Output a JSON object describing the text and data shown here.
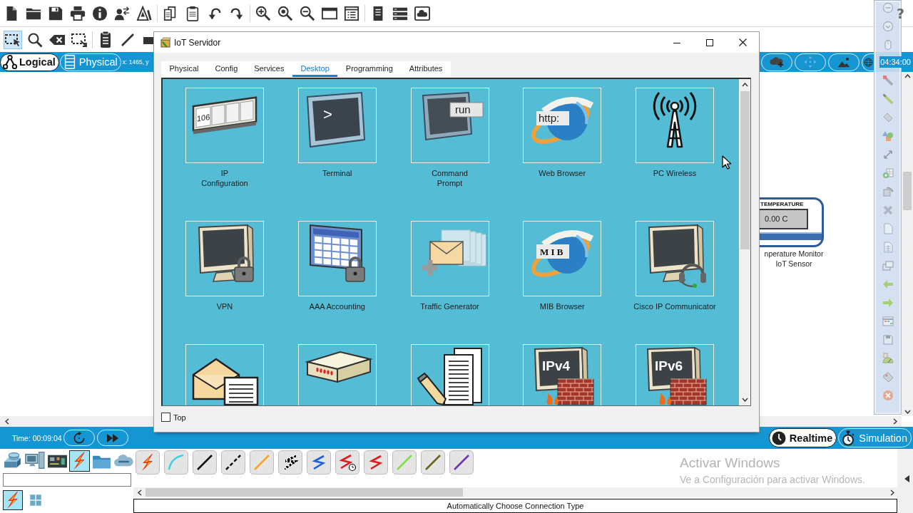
{
  "help": "?",
  "edit_tools": [
    {
      "selected": true
    },
    {
      "selected": false
    },
    {
      "selected": false
    },
    {
      "selected": false
    },
    {
      "selected": false
    },
    {
      "selected": false
    },
    {
      "selected": false
    }
  ],
  "workspace_tabs": [
    {
      "label": "Logical",
      "selected": true
    },
    {
      "label": "Physical",
      "selected": false
    }
  ],
  "cursor_coordinates": "x: 1465, y",
  "clock": "04:34:00",
  "canvas": {
    "device": {
      "display_title": "TEMPERATURE",
      "reading": "0.00 C",
      "name": "nperature Monitor\nIoT Sensor"
    }
  },
  "dialog": {
    "title": "IoT Servidor",
    "tabs": [
      {
        "label": "Physical",
        "selected": false
      },
      {
        "label": "Config",
        "selected": false
      },
      {
        "label": "Services",
        "selected": false
      },
      {
        "label": "Desktop",
        "selected": true
      },
      {
        "label": "Programming",
        "selected": false
      },
      {
        "label": "Attributes",
        "selected": false
      }
    ],
    "apps": [
      {
        "label": "IP\nConfiguration",
        "icon_text": "106",
        "clipped": false
      },
      {
        "label": "Terminal",
        "icon_text": ">",
        "clipped": false
      },
      {
        "label": "Command\nPrompt",
        "icon_text": "run",
        "clipped": false
      },
      {
        "label": "Web Browser",
        "icon_text": "http:",
        "clipped": false
      },
      {
        "label": "PC Wireless",
        "clipped": false
      },
      {
        "label": "VPN",
        "clipped": false
      },
      {
        "label": "AAA Accounting",
        "clipped": false
      },
      {
        "label": "Traffic Generator",
        "clipped": false
      },
      {
        "label": "MIB Browser",
        "icon_text": "M I B",
        "clipped": false
      },
      {
        "label": "Cisco IP Communicator",
        "clipped": false
      },
      {
        "clipped": true
      },
      {
        "clipped": true
      },
      {
        "clipped": true
      },
      {
        "icon_text": "IPv4",
        "clipped": true
      },
      {
        "icon_text": "IPv6",
        "clipped": true
      }
    ],
    "top": {
      "label": "Top",
      "checked": false
    }
  },
  "time_bar": {
    "time": "Time: 00:09:04",
    "modes": [
      {
        "label": "Realtime",
        "selected": true
      },
      {
        "label": "Simulation",
        "selected": false
      }
    ]
  },
  "device_categories": [
    {
      "selected": false
    },
    {
      "selected": false
    },
    {
      "selected": false
    },
    {
      "selected": true
    },
    {
      "selected": false
    },
    {
      "selected": false
    }
  ],
  "device_subcategories": [
    {
      "selected": true
    },
    {
      "selected": false
    }
  ],
  "connections": [
    {
      "kind": "bolt"
    },
    {
      "kind": "curve",
      "color": "#3fd0e0"
    },
    {
      "kind": "line",
      "color": "#111111"
    },
    {
      "kind": "dashed",
      "color": "#111111"
    },
    {
      "kind": "line",
      "color": "#f5a623"
    },
    {
      "kind": "dotted-zigzag",
      "color": "#111111"
    },
    {
      "kind": "zigzag",
      "color": "#1a5fe0"
    },
    {
      "kind": "zigzag-clock",
      "color": "#e01b1b"
    },
    {
      "kind": "zigzag",
      "color": "#e01b1b"
    },
    {
      "kind": "line",
      "color": "#7ee04a"
    },
    {
      "kind": "line",
      "color": "#6b6418"
    },
    {
      "kind": "line",
      "color": "#6b35b0"
    }
  ],
  "status": "Automatically Choose Connection Type",
  "os_watermark": {
    "title": "Activar Windows",
    "subtitle": "Ve a Configuración para activar Windows."
  }
}
